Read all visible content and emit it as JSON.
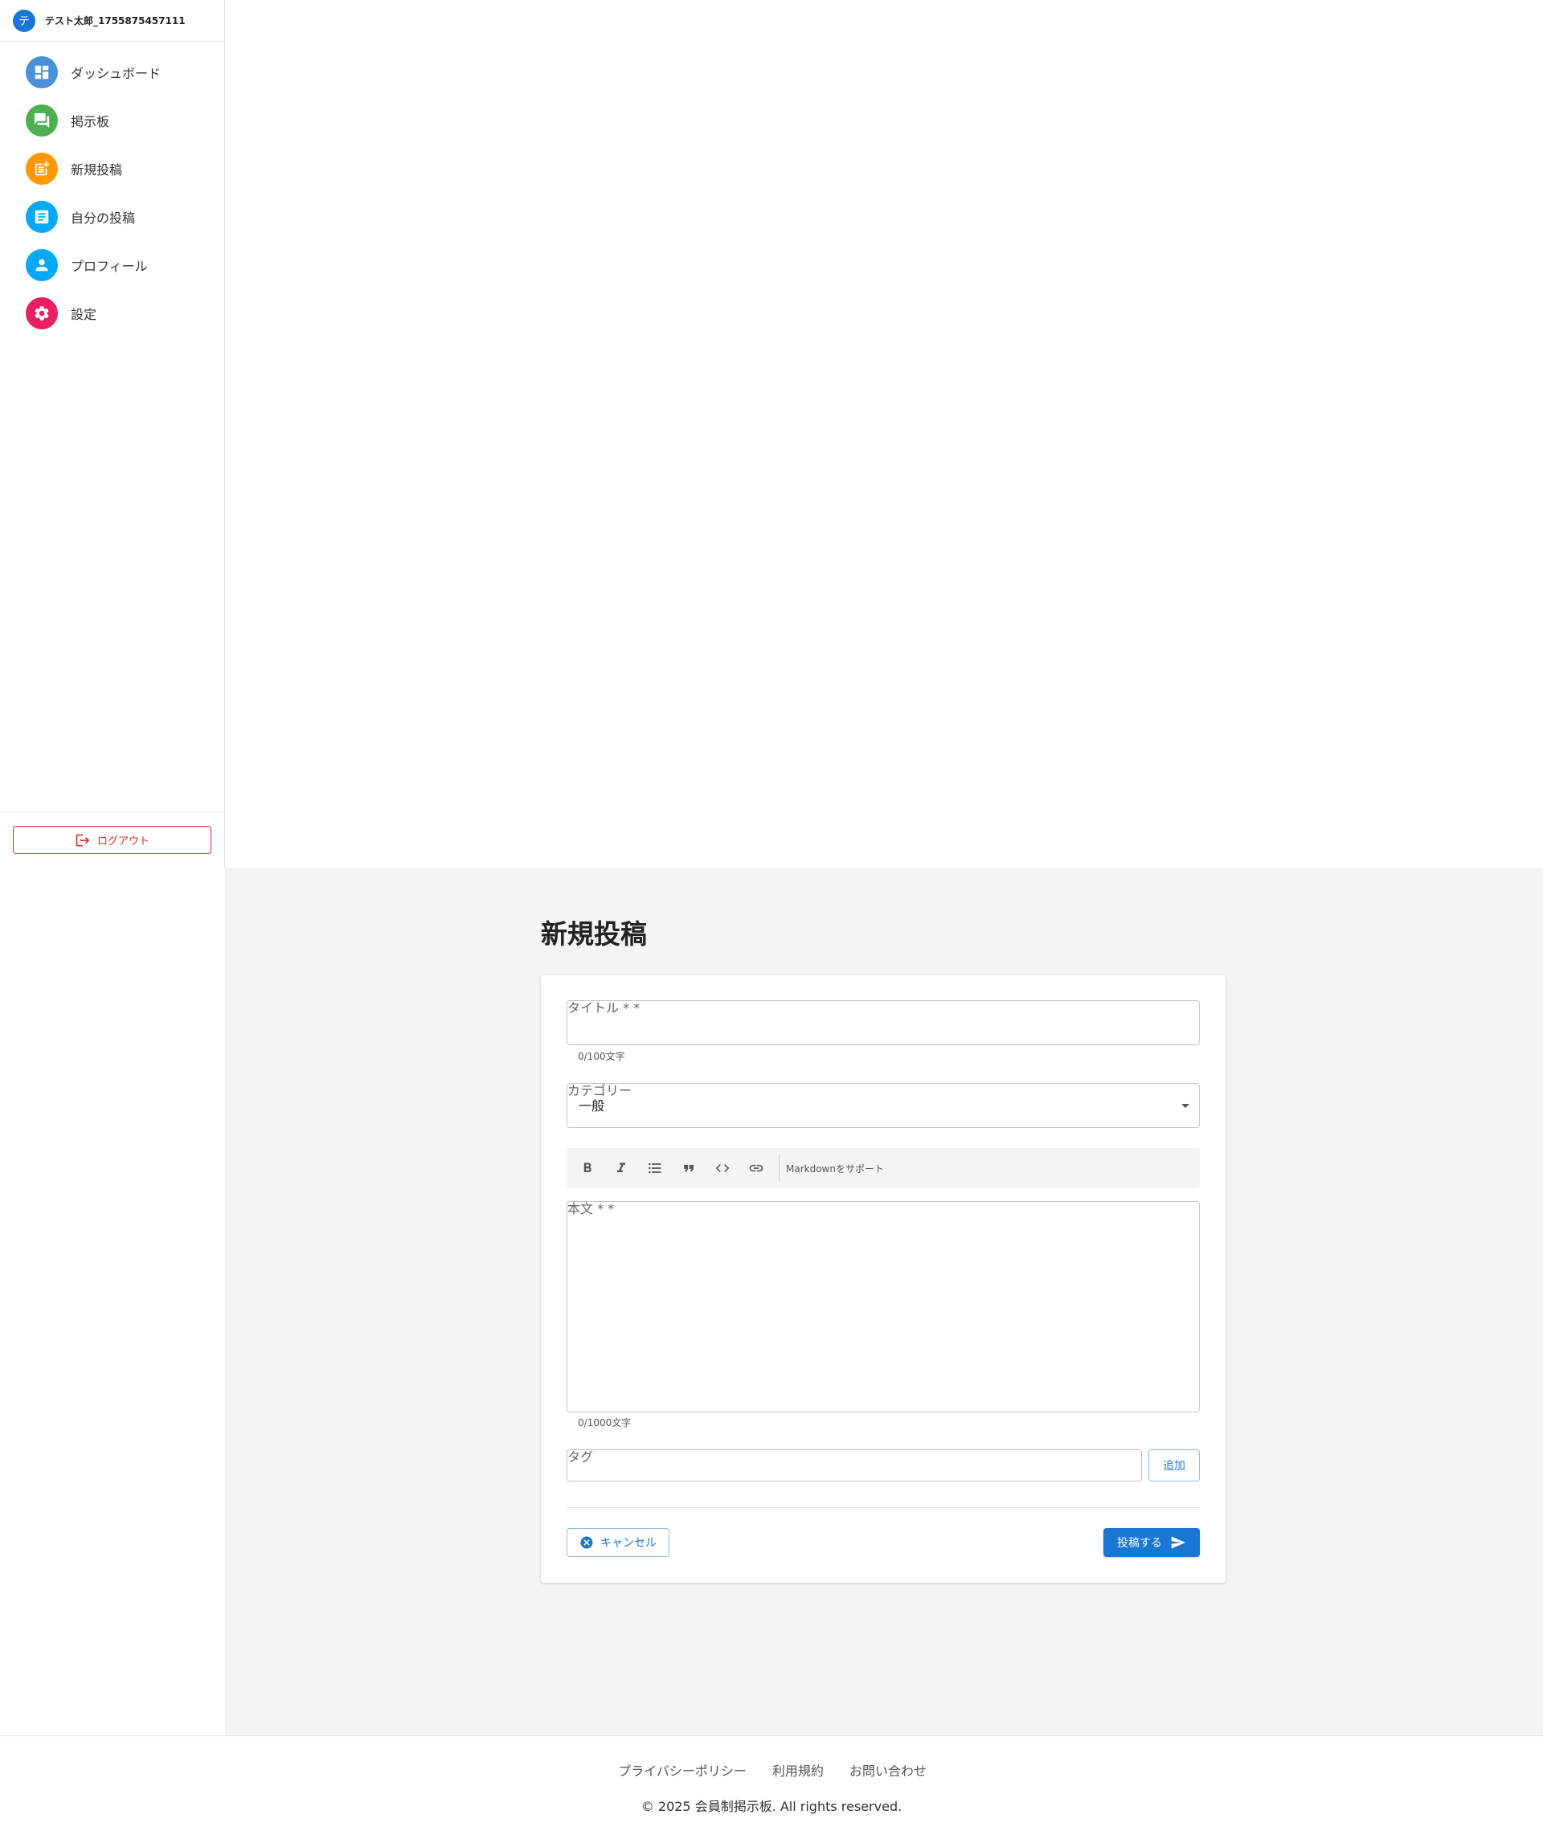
{
  "user": {
    "avatar_char": "テ",
    "name": "テスト太郎_1755875457111"
  },
  "sidebar": {
    "items": [
      {
        "label": "ダッシュボード",
        "icon": "dashboard-icon",
        "color": "#4a90d9"
      },
      {
        "label": "掲示板",
        "icon": "forum-icon",
        "color": "#4caf50"
      },
      {
        "label": "新規投稿",
        "icon": "post-add-icon",
        "color": "#ff9800"
      },
      {
        "label": "自分の投稿",
        "icon": "article-icon",
        "color": "#03a9f4"
      },
      {
        "label": "プロフィール",
        "icon": "person-icon",
        "color": "#03a9f4"
      },
      {
        "label": "設定",
        "icon": "settings-icon",
        "color": "#e91e63"
      }
    ],
    "logout_label": "ログアウト"
  },
  "main": {
    "page_title": "新規投稿",
    "form": {
      "title_label": "タイトル * *",
      "title_value": "",
      "title_counter": "0/100文字",
      "category_label": "カテゴリー",
      "category_value": "一般",
      "toolbar": {
        "buttons": [
          "bold-icon",
          "italic-icon",
          "bulleted-list-icon",
          "quote-icon",
          "code-icon",
          "link-icon"
        ],
        "note": "Markdownをサポート"
      },
      "body_label": "本文 * *",
      "body_value": "",
      "body_counter": "0/1000文字",
      "tag_label": "タグ",
      "tag_value": "",
      "add_label": "追加",
      "cancel_label": "キャンセル",
      "submit_label": "投稿する"
    }
  },
  "footer": {
    "links": [
      "プライバシーポリシー",
      "利用規約",
      "お問い合わせ"
    ],
    "copyright": "© 2025 会員制掲示板. All rights reserved."
  },
  "colors": {
    "primary": "#1976d2",
    "danger": "#d32f2f",
    "background": "#f4f4f4"
  }
}
